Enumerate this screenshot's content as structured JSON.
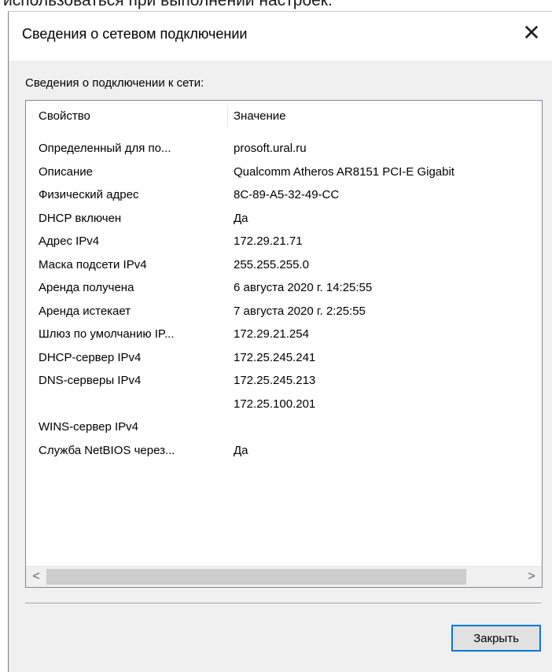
{
  "background_text": "использоваться при выполнении настроек.",
  "dialog": {
    "title": "Сведения о сетевом подключении",
    "close_icon": "close-icon",
    "section_label": "Сведения о подключении к сети:",
    "columns": {
      "property": "Свойство",
      "value": "Значение"
    },
    "rows": [
      {
        "property": "Определенный для по...",
        "value": "prosoft.ural.ru"
      },
      {
        "property": "Описание",
        "value": "Qualcomm Atheros AR8151 PCI-E Gigabit"
      },
      {
        "property": "Физический адрес",
        "value": "8C-89-A5-32-49-CC"
      },
      {
        "property": "DHCP включен",
        "value": "Да"
      },
      {
        "property": "Адрес IPv4",
        "value": "172.29.21.71"
      },
      {
        "property": "Маска подсети IPv4",
        "value": "255.255.255.0"
      },
      {
        "property": "Аренда получена",
        "value": "6 августа 2020 г. 14:25:55"
      },
      {
        "property": "Аренда истекает",
        "value": "7 августа 2020 г. 2:25:55"
      },
      {
        "property": "Шлюз по умолчанию IP...",
        "value": "172.29.21.254"
      },
      {
        "property": "DHCP-сервер IPv4",
        "value": "172.25.245.241"
      },
      {
        "property": "DNS-серверы IPv4",
        "value": "172.25.245.213"
      },
      {
        "property": "",
        "value": "172.25.100.201"
      },
      {
        "property": "WINS-сервер IPv4",
        "value": ""
      },
      {
        "property": "Служба NetBIOS через...",
        "value": "Да"
      }
    ],
    "scroll_left": "<",
    "scroll_right": ">",
    "close_button": "Закрыть"
  }
}
